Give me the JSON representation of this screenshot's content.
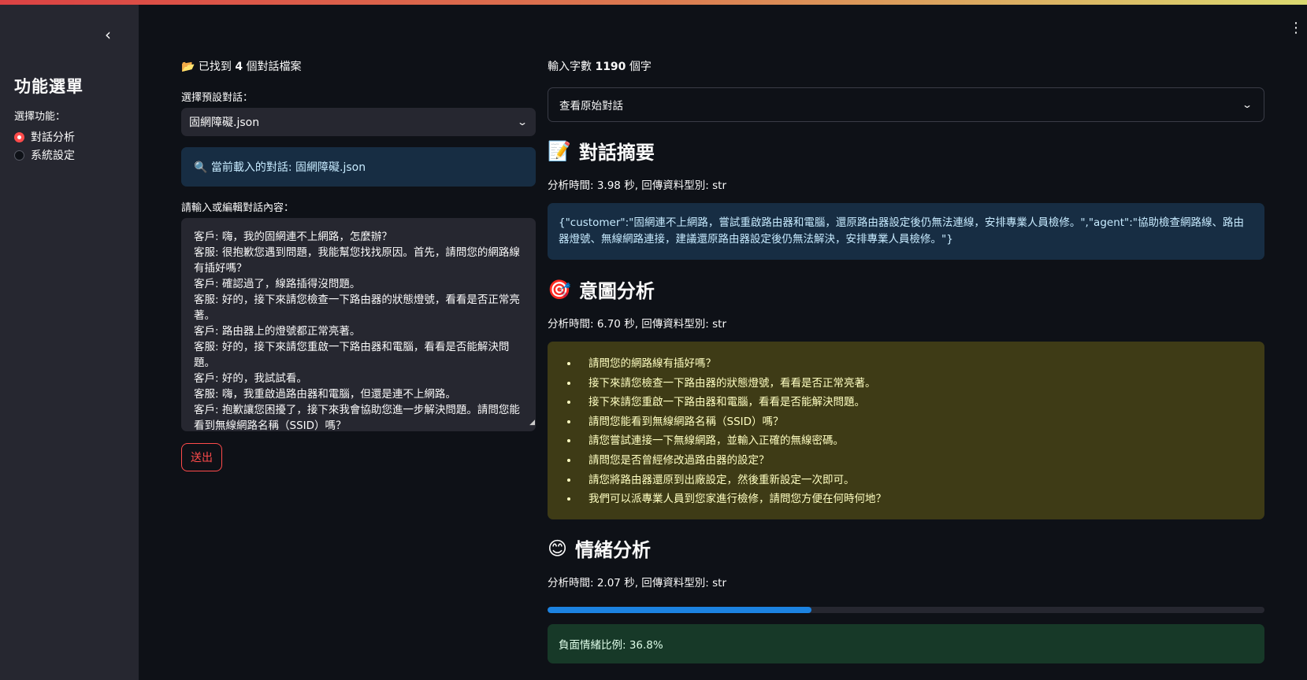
{
  "sidebar": {
    "collapse_icon": "chevron-left-icon",
    "title": "功能選單",
    "select_label": "選擇功能：",
    "options": [
      {
        "label": "對話分析",
        "selected": true
      },
      {
        "label": "系統設定",
        "selected": false
      }
    ]
  },
  "menu_icon": "kebab-menu-icon",
  "left": {
    "found_prefix": "已找到",
    "found_count": "4",
    "found_suffix": "個對話檔案",
    "select_label": "選擇預設對話：",
    "select_value": "固網障礙.json",
    "info_text": "🔍 當前載入的對話: 固網障礙.json",
    "textarea_label": "請輸入或編輯對話內容：",
    "textarea_value": "客戶: 嗨，我的固網連不上網路，怎麼辦？\n客服: 很抱歉您遇到問題，我能幫您找找原因。首先，請問您的網路線有插好嗎？\n客戶: 確認過了，線路插得沒問題。\n客服: 好的，接下來請您檢查一下路由器的狀態燈號，看看是否正常亮著。\n客戶: 路由器上的燈號都正常亮著。\n客服: 好的，接下來請您重啟一下路由器和電腦，看看是否能解決問題。\n客戶: 好的，我試試看。\n客服: 嗨，我重啟過路由器和電腦，但還是連不上網路。\n客戶: 抱歉讓您困擾了，接下來我會協助您進一步解決問題。請問您能看到無線網路名稱（SSID）嗎？",
    "send_label": "送出"
  },
  "right": {
    "wordcount_prefix": "輸入字數",
    "wordcount_value": "1190",
    "wordcount_suffix": "個字",
    "expander_label": "查看原始對話",
    "summary": {
      "icon": "📝",
      "title": "對話摘要",
      "meta": "分析時間: 3.98 秒, 回傳資料型別: str",
      "text": "{\"customer\":\"固網連不上網路，嘗試重啟路由器和電腦，還原路由器設定後仍無法連線，安排專業人員檢修。\",\"agent\":\"協助檢查網路線、路由器燈號、無線網路連接，建議還原路由器設定後仍無法解決，安排專業人員檢修。\"}"
    },
    "intent": {
      "icon": "🎯",
      "title": "意圖分析",
      "meta": "分析時間: 6.70 秒, 回傳資料型別: str",
      "items": [
        "請問您的網路線有插好嗎？",
        "接下來請您檢查一下路由器的狀態燈號，看看是否正常亮著。",
        "接下來請您重啟一下路由器和電腦，看看是否能解決問題。",
        "請問您能看到無線網路名稱（SSID）嗎？",
        "請您嘗試連接一下無線網路，並輸入正確的無線密碼。",
        "請問您是否曾經修改過路由器的設定？",
        "請您將路由器還原到出廠設定，然後重新設定一次即可。",
        "我們可以派專業人員到您家進行檢修，請問您方便在何時何地？"
      ]
    },
    "emotion": {
      "icon": "😊",
      "title": "情緒分析",
      "meta": "分析時間: 2.07 秒, 回傳資料型別: str",
      "progress": 0.368,
      "result": "負面情緒比例: 36.8%"
    }
  }
}
